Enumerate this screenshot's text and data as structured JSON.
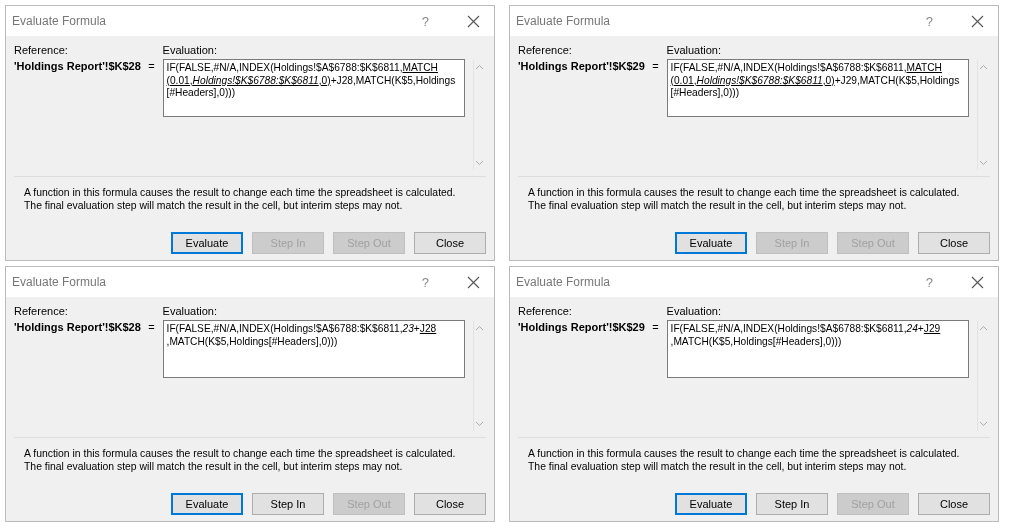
{
  "dialogs": [
    {
      "title": "Evaluate Formula",
      "help": "?",
      "reference_label": "Reference:",
      "reference": "'Holdings Report'!$K$28",
      "equals": "=",
      "evaluation_label": "Evaluation:",
      "evaluation_lines": [
        [
          {
            "text": "IF(FALSE,#N/A,INDEX(Holdings!$A$6788:$K$6811,",
            "underline": false,
            "italic": false
          },
          {
            "text": "MATCH",
            "underline": true,
            "italic": false
          }
        ],
        [
          {
            "text": "(0.01,",
            "underline": true,
            "italic": false
          },
          {
            "text": "Holdings!$K$6788:$K$6811",
            "underline": true,
            "italic": true
          },
          {
            "text": ",0)",
            "underline": true,
            "italic": false
          },
          {
            "text": "+J28,MATCH(K$5,Holdings",
            "underline": false,
            "italic": false
          }
        ],
        [
          {
            "text": "[#Headers],0)))",
            "underline": false,
            "italic": false
          }
        ]
      ],
      "message": "A function in this formula causes the result to change each time the spreadsheet is calculated.  The final evaluation step will match the result in the cell, but interim steps may not.",
      "buttons": [
        {
          "label": "Evaluate",
          "disabled": false,
          "focused": true
        },
        {
          "label": "Step In",
          "disabled": true,
          "focused": false
        },
        {
          "label": "Step Out",
          "disabled": true,
          "focused": false
        },
        {
          "label": "Close",
          "disabled": false,
          "focused": false
        }
      ]
    },
    {
      "title": "Evaluate Formula",
      "help": "?",
      "reference_label": "Reference:",
      "reference": "'Holdings Report'!$K$29",
      "equals": "=",
      "evaluation_label": "Evaluation:",
      "evaluation_lines": [
        [
          {
            "text": "IF(FALSE,#N/A,INDEX(Holdings!$A$6788:$K$6811,",
            "underline": false,
            "italic": false
          },
          {
            "text": "MATCH",
            "underline": true,
            "italic": false
          }
        ],
        [
          {
            "text": "(0.01,",
            "underline": true,
            "italic": false
          },
          {
            "text": "Holdings!$K$6788:$K$6811",
            "underline": true,
            "italic": true
          },
          {
            "text": ",0)",
            "underline": true,
            "italic": false
          },
          {
            "text": "+J29,MATCH(K$5,Holdings",
            "underline": false,
            "italic": false
          }
        ],
        [
          {
            "text": "[#Headers],0)))",
            "underline": false,
            "italic": false
          }
        ]
      ],
      "message": "A function in this formula causes the result to change each time the spreadsheet is calculated.  The final evaluation step will match the result in the cell, but interim steps may not.",
      "buttons": [
        {
          "label": "Evaluate",
          "disabled": false,
          "focused": true
        },
        {
          "label": "Step In",
          "disabled": true,
          "focused": false
        },
        {
          "label": "Step Out",
          "disabled": true,
          "focused": false
        },
        {
          "label": "Close",
          "disabled": false,
          "focused": false
        }
      ]
    },
    {
      "title": "Evaluate Formula",
      "help": "?",
      "reference_label": "Reference:",
      "reference": "'Holdings Report'!$K$28",
      "equals": "=",
      "evaluation_label": "Evaluation:",
      "evaluation_lines": [
        [
          {
            "text": "IF(FALSE,#N/A,INDEX(Holdings!$A$6788:$K$6811,",
            "underline": false,
            "italic": false
          },
          {
            "text": "23",
            "underline": false,
            "italic": true
          },
          {
            "text": "+",
            "underline": false,
            "italic": false
          },
          {
            "text": "J28",
            "underline": true,
            "italic": false
          }
        ],
        [
          {
            "text": ",MATCH(K$5,Holdings[#Headers],0)))",
            "underline": false,
            "italic": false
          }
        ]
      ],
      "message": "A function in this formula causes the result to change each time the spreadsheet is calculated.  The final evaluation step will match the result in the cell, but interim steps may not.",
      "buttons": [
        {
          "label": "Evaluate",
          "disabled": false,
          "focused": true
        },
        {
          "label": "Step In",
          "disabled": false,
          "focused": false
        },
        {
          "label": "Step Out",
          "disabled": true,
          "focused": false
        },
        {
          "label": "Close",
          "disabled": false,
          "focused": false
        }
      ]
    },
    {
      "title": "Evaluate Formula",
      "help": "?",
      "reference_label": "Reference:",
      "reference": "'Holdings Report'!$K$29",
      "equals": "=",
      "evaluation_label": "Evaluation:",
      "evaluation_lines": [
        [
          {
            "text": "IF(FALSE,#N/A,INDEX(Holdings!$A$6788:$K$6811,",
            "underline": false,
            "italic": false
          },
          {
            "text": "24",
            "underline": false,
            "italic": true
          },
          {
            "text": "+",
            "underline": false,
            "italic": false
          },
          {
            "text": "J29",
            "underline": true,
            "italic": false
          }
        ],
        [
          {
            "text": ",MATCH(K$5,Holdings[#Headers],0)))",
            "underline": false,
            "italic": false
          }
        ]
      ],
      "message": "A function in this formula causes the result to change each time the spreadsheet is calculated.  The final evaluation step will match the result in the cell, but interim steps may not.",
      "buttons": [
        {
          "label": "Evaluate",
          "disabled": false,
          "focused": true
        },
        {
          "label": "Step In",
          "disabled": false,
          "focused": false
        },
        {
          "label": "Step Out",
          "disabled": true,
          "focused": false
        },
        {
          "label": "Close",
          "disabled": false,
          "focused": false
        }
      ]
    }
  ]
}
